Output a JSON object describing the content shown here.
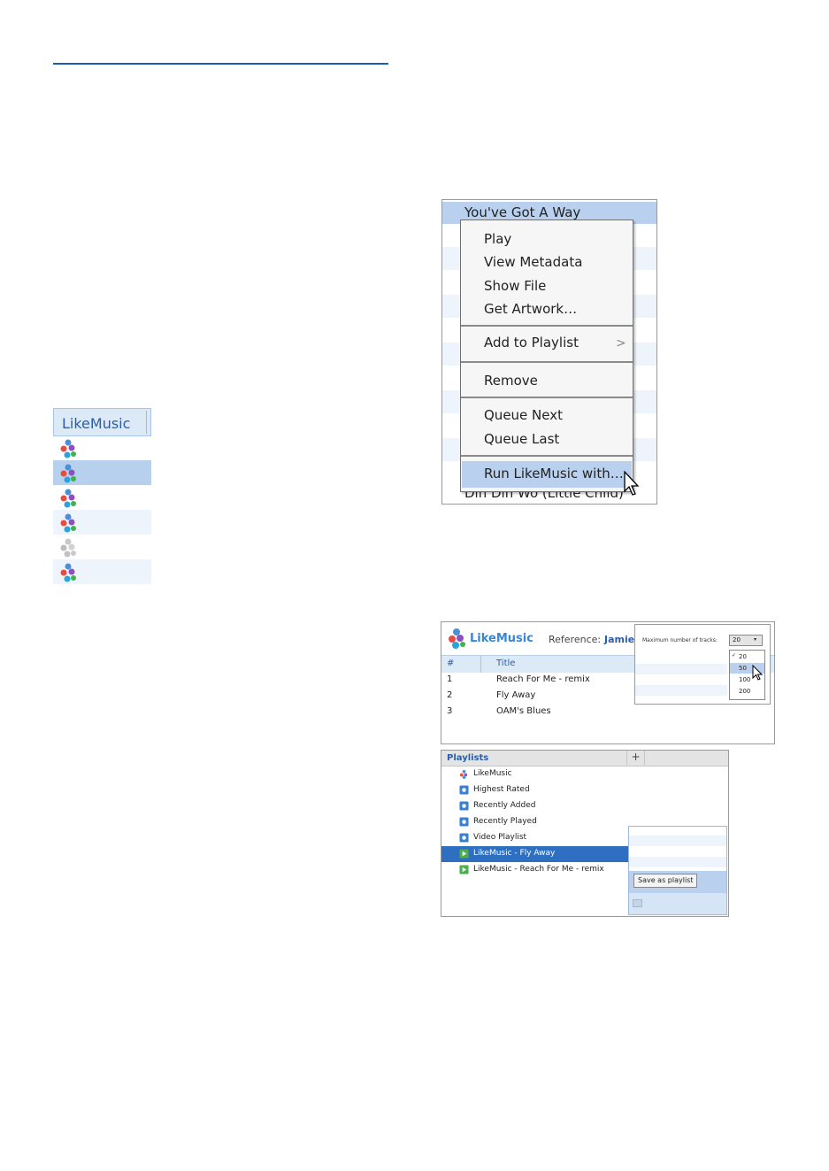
{
  "likemusic_column": {
    "header": "LikeMusic",
    "rows": [
      {
        "state": "normal",
        "icon": "likemusic-icon"
      },
      {
        "state": "selected",
        "icon": "likemusic-icon"
      },
      {
        "state": "normal",
        "icon": "likemusic-icon"
      },
      {
        "state": "alt",
        "icon": "likemusic-icon"
      },
      {
        "state": "disabled",
        "icon": "likemusic-icon-grey"
      },
      {
        "state": "alt",
        "icon": "likemusic-icon"
      }
    ]
  },
  "context_screenshot": {
    "selected_song": "You've Got A Way",
    "bottom_song": "Din Din Wo (Little Child)",
    "menu": {
      "items": [
        "Play",
        "View Metadata",
        "Show File",
        "Get Artwork…"
      ],
      "add_to_playlist": "Add to Playlist",
      "remove": "Remove",
      "queue": [
        "Queue Next",
        "Queue Last"
      ],
      "run": "Run LikeMusic with…"
    }
  },
  "reference_screenshot": {
    "logo": "LikeMusic",
    "reference_label": "Reference:",
    "reference_name": "Jamie",
    "columns": [
      "#",
      "Title"
    ],
    "rows": [
      {
        "num": "1",
        "title": "Reach For Me - remix"
      },
      {
        "num": "2",
        "title": "Fly Away"
      },
      {
        "num": "3",
        "title": "OAM's Blues"
      }
    ],
    "popup": {
      "label": "Maximum number of tracks:",
      "selected_value": "20",
      "options": [
        "20",
        "50",
        "100",
        "200"
      ],
      "checked_option": "20",
      "hovered_option": "50"
    }
  },
  "playlists_screenshot": {
    "header": "Playlists",
    "add_symbol": "+",
    "items": [
      {
        "label": "LikeMusic",
        "icon": "likemusic-icon"
      },
      {
        "label": "Highest Rated",
        "icon": "smart-playlist-icon"
      },
      {
        "label": "Recently Added",
        "icon": "smart-playlist-icon"
      },
      {
        "label": "Recently Played",
        "icon": "smart-playlist-icon"
      },
      {
        "label": "Video Playlist",
        "icon": "smart-playlist-icon"
      },
      {
        "label": "LikeMusic - Fly Away",
        "icon": "playlist-icon",
        "selected": true
      },
      {
        "label": "LikeMusic - Reach For Me - remix",
        "icon": "playlist-icon"
      }
    ],
    "save_button": "Save as playlist"
  }
}
